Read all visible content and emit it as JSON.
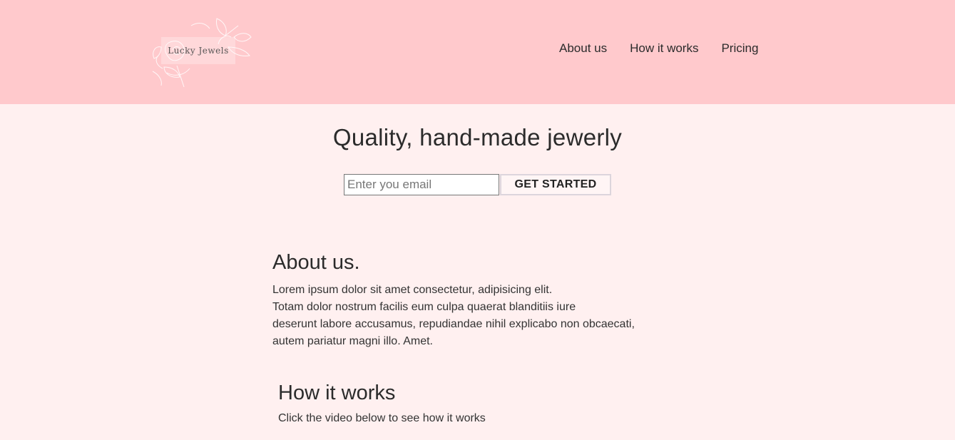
{
  "brand": {
    "name": "Lucky Jewels",
    "logo_icon": "rose-outline-icon"
  },
  "nav": {
    "items": [
      {
        "label": "About us"
      },
      {
        "label": "How it works"
      },
      {
        "label": "Pricing"
      }
    ]
  },
  "hero": {
    "title": "Quality, hand-made jewerly",
    "email_placeholder": "Enter you email",
    "cta_label": "GET STARTED"
  },
  "about": {
    "heading": "About us.",
    "lines": [
      "Lorem ipsum dolor sit amet consectetur, adipisicing elit.",
      "Totam dolor nostrum facilis eum culpa quaerat blanditiis iure",
      "deserunt labore accusamus, repudiandae nihil explicabo non obcaecati,",
      "autem pariatur magni illo. Amet."
    ]
  },
  "how_it_works": {
    "heading": "How it works",
    "text": "Click the video below to see how it works"
  },
  "colors": {
    "header_bg": "#ffc9cc",
    "page_bg": "#fff0f0"
  }
}
